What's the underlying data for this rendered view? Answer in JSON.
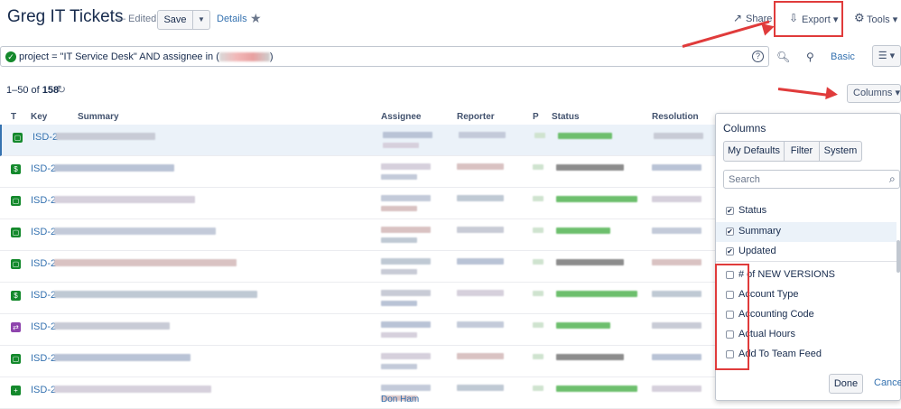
{
  "header": {
    "title": "Greg IT Tickets",
    "edited": "— Edited",
    "save_label": "Save",
    "details_label": "Details",
    "share_label": "Share",
    "export_label": "Export ▾",
    "tools_label": "Tools ▾"
  },
  "search": {
    "jql": "project = \"IT Service Desk\"  AND assignee in (",
    "jql_close": ")",
    "basic_label": "Basic"
  },
  "results": {
    "count_prefix": "1–50 of ",
    "total": "158",
    "columns_label": "Columns ▾"
  },
  "table": {
    "headers": [
      "T",
      "Key",
      "Summary",
      "Assignee",
      "Reporter",
      "P",
      "Status",
      "Resolution"
    ],
    "rows": [
      {
        "key": "ISD-2",
        "type_color": "#14892c",
        "type_glyph": "▢"
      },
      {
        "key": "ISD-2",
        "type_color": "#14892c",
        "type_glyph": "$"
      },
      {
        "key": "ISD-2",
        "type_color": "#14892c",
        "type_glyph": "▢"
      },
      {
        "key": "ISD-2",
        "type_color": "#14892c",
        "type_glyph": "▢"
      },
      {
        "key": "ISD-2",
        "type_color": "#14892c",
        "type_glyph": "▢"
      },
      {
        "key": "ISD-2",
        "type_color": "#14892c",
        "type_glyph": "$"
      },
      {
        "key": "ISD-2",
        "type_color": "#8e44ad",
        "type_glyph": "⇄"
      },
      {
        "key": "ISD-2",
        "type_color": "#14892c",
        "type_glyph": "▢"
      },
      {
        "key": "ISD-2",
        "type_color": "#14892c",
        "type_glyph": "+"
      }
    ],
    "footer_assignee": "Don Ham"
  },
  "columns_popup": {
    "title": "Columns",
    "tabs": [
      "My Defaults",
      "Filter",
      "System"
    ],
    "search_placeholder": "Search",
    "options": [
      {
        "label": "Status",
        "checked": true
      },
      {
        "label": "Summary",
        "checked": true
      },
      {
        "label": "Updated",
        "checked": true
      },
      {
        "label": "# of NEW VERSIONS",
        "checked": false
      },
      {
        "label": "Account Type",
        "checked": false
      },
      {
        "label": "Accounting Code",
        "checked": false
      },
      {
        "label": "Actual Hours",
        "checked": false
      },
      {
        "label": "Add To Team Feed",
        "checked": false
      }
    ],
    "done_label": "Done",
    "cancel_label": "Cancel"
  },
  "colors": {
    "link": "#3572b0",
    "annotation_red": "#e03b3b",
    "success": "#14892c"
  }
}
